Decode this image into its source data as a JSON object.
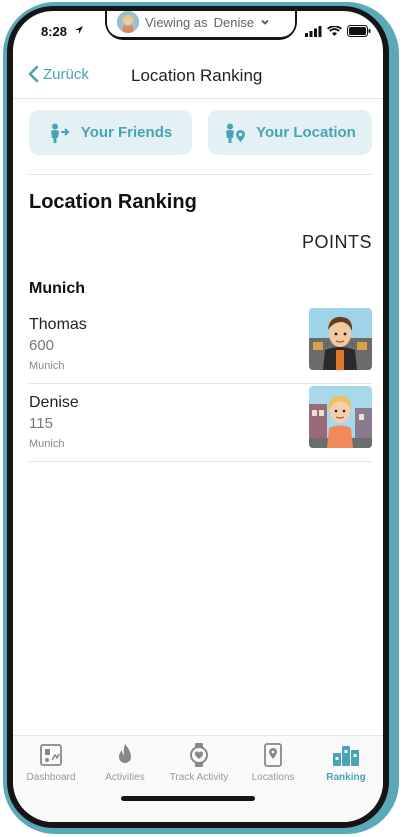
{
  "status_bar": {
    "time": "8:28"
  },
  "viewing": {
    "prefix": "Viewing as",
    "user": "Denise"
  },
  "header": {
    "back_label": "Zurück",
    "title": "Location Ranking"
  },
  "tabs": [
    {
      "label": "Your Friends",
      "icon": "friends-icon"
    },
    {
      "label": "Your Location",
      "icon": "location-person-icon"
    }
  ],
  "ranking": {
    "title": "Location Ranking",
    "points_header": "POINTS",
    "group": "Munich",
    "entries": [
      {
        "name": "Thomas",
        "points": "600",
        "city": "Munich"
      },
      {
        "name": "Denise",
        "points": "115",
        "city": "Munich"
      }
    ]
  },
  "bottom_nav": {
    "items": [
      {
        "label": "Dashboard",
        "icon": "dashboard-icon",
        "active": false
      },
      {
        "label": "Activities",
        "icon": "flame-icon",
        "active": false
      },
      {
        "label": "Track Activity",
        "icon": "watch-icon",
        "active": false
      },
      {
        "label": "Locations",
        "icon": "location-pin-icon",
        "active": false
      },
      {
        "label": "Ranking",
        "icon": "ranking-icon",
        "active": true
      }
    ]
  },
  "colors": {
    "accent": "#4aa3b5",
    "tab_bg": "#e3f1f4",
    "frame": "#5aa9b9"
  }
}
